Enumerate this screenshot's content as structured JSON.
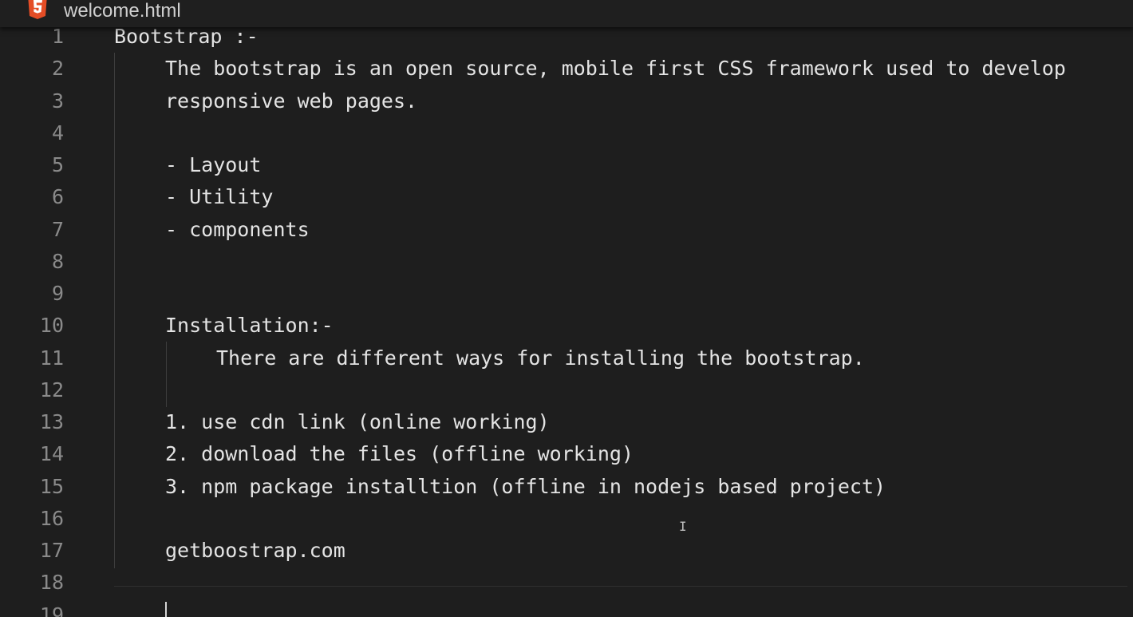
{
  "tab": {
    "title": "welcome.html",
    "icon": "html5-icon",
    "icon_color": "#e44d26"
  },
  "lines": [
    {
      "n": "1",
      "text": "Bootstrap :-",
      "indent": 0
    },
    {
      "n": "2",
      "text": "The bootstrap is an open source, mobile first CSS framework used to develop",
      "indent": 1
    },
    {
      "n": "3",
      "text": "responsive web pages.",
      "indent": 1
    },
    {
      "n": "4",
      "text": "",
      "indent": 0
    },
    {
      "n": "5",
      "text": "- Layout",
      "indent": 1
    },
    {
      "n": "6",
      "text": "- Utility",
      "indent": 1
    },
    {
      "n": "7",
      "text": "- components",
      "indent": 1
    },
    {
      "n": "8",
      "text": "",
      "indent": 0
    },
    {
      "n": "9",
      "text": "",
      "indent": 0
    },
    {
      "n": "10",
      "text": "Installation:-",
      "indent": 1
    },
    {
      "n": "11",
      "text": "There are different ways for installing the bootstrap.",
      "indent": 2
    },
    {
      "n": "12",
      "text": "",
      "indent": 0
    },
    {
      "n": "13",
      "text": "1. use cdn link (online working)",
      "indent": 1
    },
    {
      "n": "14",
      "text": "2. download the files (offline working)",
      "indent": 1
    },
    {
      "n": "15",
      "text": "3. npm package installtion (offline in nodejs based project)",
      "indent": 1
    },
    {
      "n": "16",
      "text": "",
      "indent": 0
    },
    {
      "n": "17",
      "text": "getboostrap.com",
      "indent": 1
    },
    {
      "n": "18",
      "text": "",
      "indent": 0
    },
    {
      "n": "19",
      "text": "",
      "indent": 0
    }
  ],
  "colors": {
    "background": "#1e1e1e",
    "text": "#e4e4e4",
    "line_number": "#8a8a8a"
  }
}
